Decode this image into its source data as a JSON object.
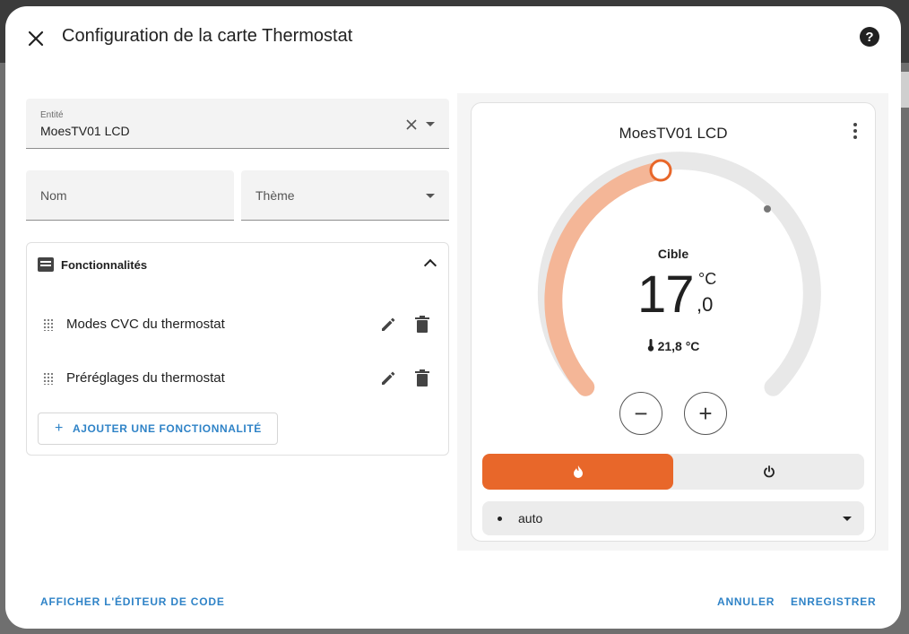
{
  "dialog": {
    "title": "Configuration de la carte Thermostat",
    "help_glyph": "?"
  },
  "form": {
    "entity": {
      "label": "Entité",
      "value": "MoesTV01 LCD"
    },
    "name": {
      "placeholder": "Nom"
    },
    "theme": {
      "placeholder": "Thème"
    }
  },
  "features": {
    "title": "Fonctionnalités",
    "items": [
      {
        "label": "Modes CVC du thermostat"
      },
      {
        "label": "Préréglages du thermostat"
      }
    ],
    "add_label": "AJOUTER UNE FONCTIONNALITÉ",
    "add_glyph": "+"
  },
  "preview": {
    "card_title": "MoesTV01 LCD",
    "target_label": "Cible",
    "target_integer": "17",
    "target_decimal": ",0",
    "unit": "°C",
    "current_temperature": "21,8 °C",
    "minus_glyph": "−",
    "plus_glyph": "+",
    "preset_value": "auto",
    "colors": {
      "heat": "#e8672a",
      "heat_arc": "#f4b697",
      "track": "#e8e8e8"
    },
    "active_mode": "heat"
  },
  "footer": {
    "code_editor": "AFFICHER L'ÉDITEUR DE CODE",
    "cancel": "ANNULER",
    "save": "ENREGISTRER"
  }
}
